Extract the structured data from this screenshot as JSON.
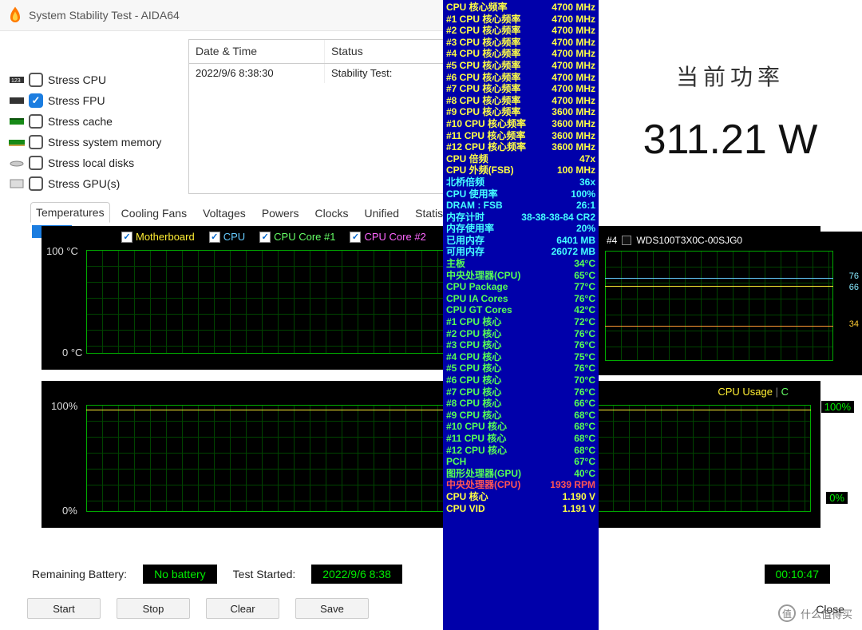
{
  "window": {
    "title": "System Stability Test - AIDA64"
  },
  "stress": {
    "items": [
      {
        "label": "Stress CPU",
        "checked": false
      },
      {
        "label": "Stress FPU",
        "checked": true
      },
      {
        "label": "Stress cache",
        "checked": false
      },
      {
        "label": "Stress system memory",
        "checked": false
      },
      {
        "label": "Stress local disks",
        "checked": false
      },
      {
        "label": "Stress GPU(s)",
        "checked": false
      }
    ]
  },
  "log": {
    "headers": {
      "date": "Date & Time",
      "status": "Status"
    },
    "row": {
      "date": "2022/9/6 8:38:30",
      "status": "Stability Test:"
    }
  },
  "power": {
    "title": "当前功率",
    "value": "311.21 W"
  },
  "tabs": [
    "Temperatures",
    "Cooling Fans",
    "Voltages",
    "Powers",
    "Clocks",
    "Unified",
    "Statisti"
  ],
  "graph1": {
    "legend": [
      "Motherboard",
      "CPU",
      "CPU Core #1",
      "CPU Core #2"
    ],
    "y_hi": "100 °C",
    "y_lo": "0 °C"
  },
  "right_graph": {
    "legend_index": "#4",
    "legend_label": "WDS100T3X0C-00SJG0",
    "labels": {
      "a": "76",
      "a2": "76",
      "b": "66",
      "c": "34"
    }
  },
  "graph2": {
    "title_usage": "CPU Usage",
    "title_sep": "|",
    "title_c": "C",
    "y_hi": "100%",
    "y_lo": "0%",
    "right_hi": "100%",
    "right_lo": "0%"
  },
  "status": {
    "battery_label": "Remaining Battery:",
    "battery_value": "No battery",
    "started_label": "Test Started:",
    "started_value": "2022/9/6 8:38",
    "elapsed": "00:10:47"
  },
  "buttons": {
    "start": "Start",
    "stop": "Stop",
    "clear": "Clear",
    "save": "Save",
    "close": "Close"
  },
  "watermark": {
    "glyph": "值",
    "text": "什么值得买"
  },
  "sensors": [
    {
      "n": "CPU 核心频率",
      "v": "4700 MHz",
      "c": "yellow"
    },
    {
      "n": "#1 CPU 核心频率",
      "v": "4700 MHz",
      "c": "yellow"
    },
    {
      "n": "#2 CPU 核心频率",
      "v": "4700 MHz",
      "c": "yellow"
    },
    {
      "n": "#3 CPU 核心频率",
      "v": "4700 MHz",
      "c": "yellow"
    },
    {
      "n": "#4 CPU 核心频率",
      "v": "4700 MHz",
      "c": "yellow"
    },
    {
      "n": "#5 CPU 核心频率",
      "v": "4700 MHz",
      "c": "yellow"
    },
    {
      "n": "#6 CPU 核心频率",
      "v": "4700 MHz",
      "c": "yellow"
    },
    {
      "n": "#7 CPU 核心频率",
      "v": "4700 MHz",
      "c": "yellow"
    },
    {
      "n": "#8 CPU 核心频率",
      "v": "4700 MHz",
      "c": "yellow"
    },
    {
      "n": "#9 CPU 核心频率",
      "v": "3600 MHz",
      "c": "yellow"
    },
    {
      "n": "#10 CPU 核心频率",
      "v": "3600 MHz",
      "c": "yellow"
    },
    {
      "n": "#11 CPU 核心频率",
      "v": "3600 MHz",
      "c": "yellow"
    },
    {
      "n": "#12 CPU 核心频率",
      "v": "3600 MHz",
      "c": "yellow"
    },
    {
      "n": "CPU 倍频",
      "v": "47x",
      "c": "yellow"
    },
    {
      "n": "CPU 外频(FSB)",
      "v": "100 MHz",
      "c": "yellow"
    },
    {
      "n": "北桥倍频",
      "v": "36x",
      "c": "cyan"
    },
    {
      "n": "CPU 使用率",
      "v": "100%",
      "c": "cyan"
    },
    {
      "n": "DRAM : FSB",
      "v": "26:1",
      "c": "cyan"
    },
    {
      "n": "内存计时",
      "v": "38-38-38-84 CR2",
      "c": "cyan"
    },
    {
      "n": "内存使用率",
      "v": "20%",
      "c": "cyan"
    },
    {
      "n": "已用内存",
      "v": "6401 MB",
      "c": "cyan"
    },
    {
      "n": "可用内存",
      "v": "26072 MB",
      "c": "cyan"
    },
    {
      "n": "主板",
      "v": "34°C",
      "c": "green"
    },
    {
      "n": "中央处理器(CPU)",
      "v": "65°C",
      "c": "green"
    },
    {
      "n": "CPU Package",
      "v": "77°C",
      "c": "green"
    },
    {
      "n": "CPU IA Cores",
      "v": "76°C",
      "c": "green"
    },
    {
      "n": "CPU GT Cores",
      "v": "42°C",
      "c": "green"
    },
    {
      "n": "#1 CPU 核心",
      "v": "72°C",
      "c": "green"
    },
    {
      "n": "#2 CPU 核心",
      "v": "76°C",
      "c": "green"
    },
    {
      "n": "#3 CPU 核心",
      "v": "76°C",
      "c": "green"
    },
    {
      "n": "#4 CPU 核心",
      "v": "75°C",
      "c": "green"
    },
    {
      "n": "#5 CPU 核心",
      "v": "76°C",
      "c": "green"
    },
    {
      "n": "#6 CPU 核心",
      "v": "70°C",
      "c": "green"
    },
    {
      "n": "#7 CPU 核心",
      "v": "76°C",
      "c": "green"
    },
    {
      "n": "#8 CPU 核心",
      "v": "66°C",
      "c": "green"
    },
    {
      "n": "#9 CPU 核心",
      "v": "68°C",
      "c": "green"
    },
    {
      "n": "#10 CPU 核心",
      "v": "68°C",
      "c": "green"
    },
    {
      "n": "#11 CPU 核心",
      "v": "68°C",
      "c": "green"
    },
    {
      "n": "#12 CPU 核心",
      "v": "68°C",
      "c": "green"
    },
    {
      "n": "PCH",
      "v": "67°C",
      "c": "green"
    },
    {
      "n": "图形处理器(GPU)",
      "v": "40°C",
      "c": "green"
    },
    {
      "n": "中央处理器(CPU)",
      "v": "1939 RPM",
      "c": "red"
    },
    {
      "n": "CPU 核心",
      "v": "1.190 V",
      "c": "yellow"
    },
    {
      "n": "CPU VID",
      "v": "1.191 V",
      "c": "yellow"
    }
  ]
}
